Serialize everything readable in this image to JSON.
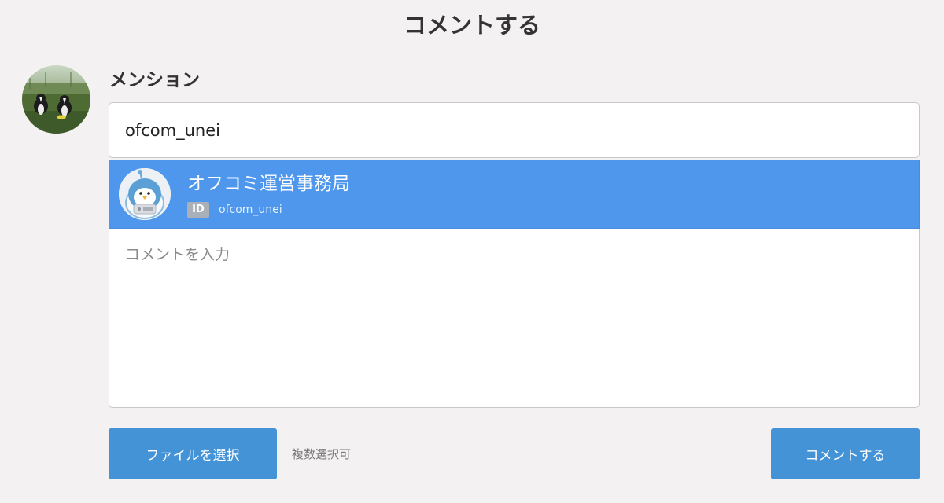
{
  "page": {
    "title": "コメントする"
  },
  "mention": {
    "label": "メンション",
    "input_value": "ofcom_unei"
  },
  "suggestions": [
    {
      "name": "オフコミ運営事務局",
      "id_badge": "ID",
      "handle": "ofcom_unei"
    }
  ],
  "comment": {
    "placeholder": "コメントを入力"
  },
  "actions": {
    "file_button_label": "ファイルを選択",
    "multi_select_note": "複数選択可",
    "submit_label": "コメントする"
  },
  "colors": {
    "background": "#f3f1f2",
    "selected_suggestion": "#4e97ec",
    "button": "#4493d6"
  }
}
